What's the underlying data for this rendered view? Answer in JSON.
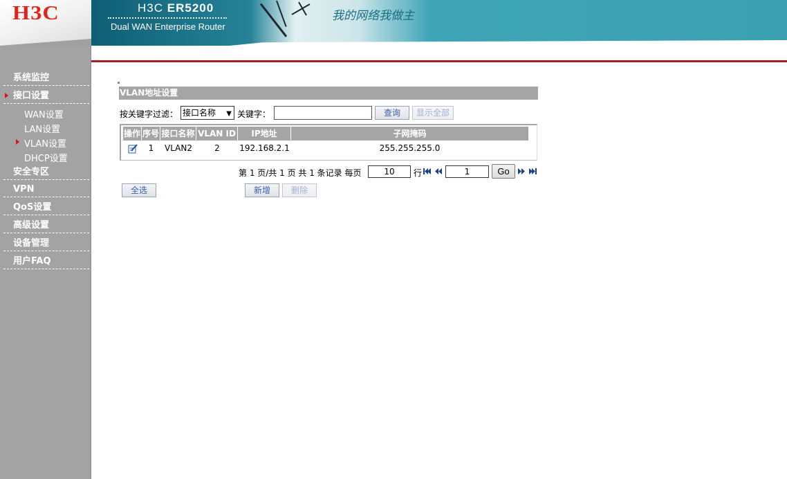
{
  "header": {
    "logo": "H3C",
    "product_prefix": "H3C",
    "product_model": "ER5200",
    "tagline": "Dual WAN Enterprise Router",
    "slogan": "我的网络我做主"
  },
  "sidebar": {
    "items": [
      {
        "label": "系统监控"
      },
      {
        "label": "接口设置",
        "active": true
      },
      {
        "label": "安全专区"
      },
      {
        "label": "VPN"
      },
      {
        "label": "QoS设置"
      },
      {
        "label": "高级设置"
      },
      {
        "label": "设备管理"
      },
      {
        "label": "用户FAQ"
      }
    ],
    "sub_items": [
      {
        "label": "WAN设置"
      },
      {
        "label": "LAN设置"
      },
      {
        "label": "VLAN设置",
        "active": true
      },
      {
        "label": "DHCP设置"
      }
    ]
  },
  "main": {
    "section_title": "VLAN地址设置",
    "filter": {
      "label": "按关键字过滤：",
      "field_value": "接口名称",
      "keyword_label": "关键字：",
      "keyword_value": "",
      "search_button": "查询",
      "show_all_button": "显示全部"
    },
    "table": {
      "columns": [
        "操作",
        "序号",
        "接口名称",
        "VLAN ID",
        "IP地址",
        "子网掩码"
      ],
      "rows": [
        {
          "seq": "1",
          "name": "VLAN2",
          "vlan_id": "2",
          "ip": "192.168.2.1",
          "mask": "255.255.255.0"
        }
      ]
    },
    "pager": {
      "page_text": "第 1 页/共 1 页 共 1 条记录 每页",
      "per_page": "10",
      "rows_label": "行",
      "page_input": "1",
      "go_button": "Go"
    },
    "actions": {
      "select_all": "全选",
      "add": "新增",
      "delete": "删除"
    }
  },
  "colors": {
    "accent_red": "#a71d24",
    "sidebar_bg": "#a3a3a3",
    "header_teal": "#3ea5b7",
    "logo_red": "#e2231a"
  }
}
